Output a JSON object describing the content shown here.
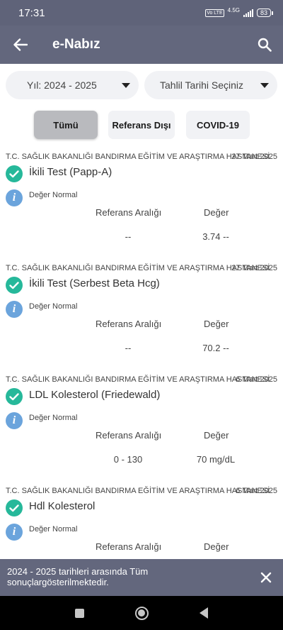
{
  "status_bar": {
    "time": "17:31",
    "volte": "Vo LTE",
    "network": "4.5G",
    "battery": "83"
  },
  "app_bar": {
    "title": "e-Nabız",
    "back_icon": "arrow-left-icon",
    "search_icon": "search-icon"
  },
  "filters": {
    "year": "Yıl: 2024 - 2025",
    "date": "Tahlil Tarihi Seçiniz",
    "buttons": [
      "Tümü",
      "Referans Dışı",
      "COVID-19"
    ],
    "selected": "Tümü"
  },
  "table_headers": {
    "reference_range": "Referans Aralığı",
    "value": "Değer"
  },
  "results": [
    {
      "institution": "T.C. SAĞLIK BAKANLIĞI BANDIRMA EĞİTİM VE ARAŞTIRMA HASTANESİ",
      "date": "27 Mart 2025",
      "test_name": "İkili Test (Papp-A)",
      "status": "Değer Normal",
      "reference": "--",
      "value": "3.74 --"
    },
    {
      "institution": "T.C. SAĞLIK BAKANLIĞI BANDIRMA EĞİTİM VE ARAŞTIRMA HASTANESİ",
      "date": "27 Mart 2025",
      "test_name": "İkili Test (Serbest Beta Hcg)",
      "status": "Değer Normal",
      "reference": "--",
      "value": "70.2 --"
    },
    {
      "institution": "T.C. SAĞLIK BAKANLIĞI BANDIRMA EĞİTİM VE ARAŞTIRMA HASTANESİ",
      "date": "6 Mart 2025",
      "test_name": "LDL Kolesterol (Friedewald)",
      "status": "Değer Normal",
      "reference": "0 - 130",
      "value": "70 mg/dL"
    },
    {
      "institution": "T.C. SAĞLIK BAKANLIĞI BANDIRMA EĞİTİM VE ARAŞTIRMA HASTANESİ",
      "date": "6 Mart 2025",
      "test_name": "Hdl Kolesterol",
      "status": "Değer Normal",
      "reference": "",
      "value": ""
    }
  ],
  "snackbar": {
    "message": "2024 - 2025 tarihleri arasında Tüm sonuçlargösterilmektedir.",
    "close_icon": "close-icon"
  },
  "colors": {
    "app_bar": "#63677d",
    "check_green": "#26b89a",
    "info_blue": "#6ba4dc"
  }
}
